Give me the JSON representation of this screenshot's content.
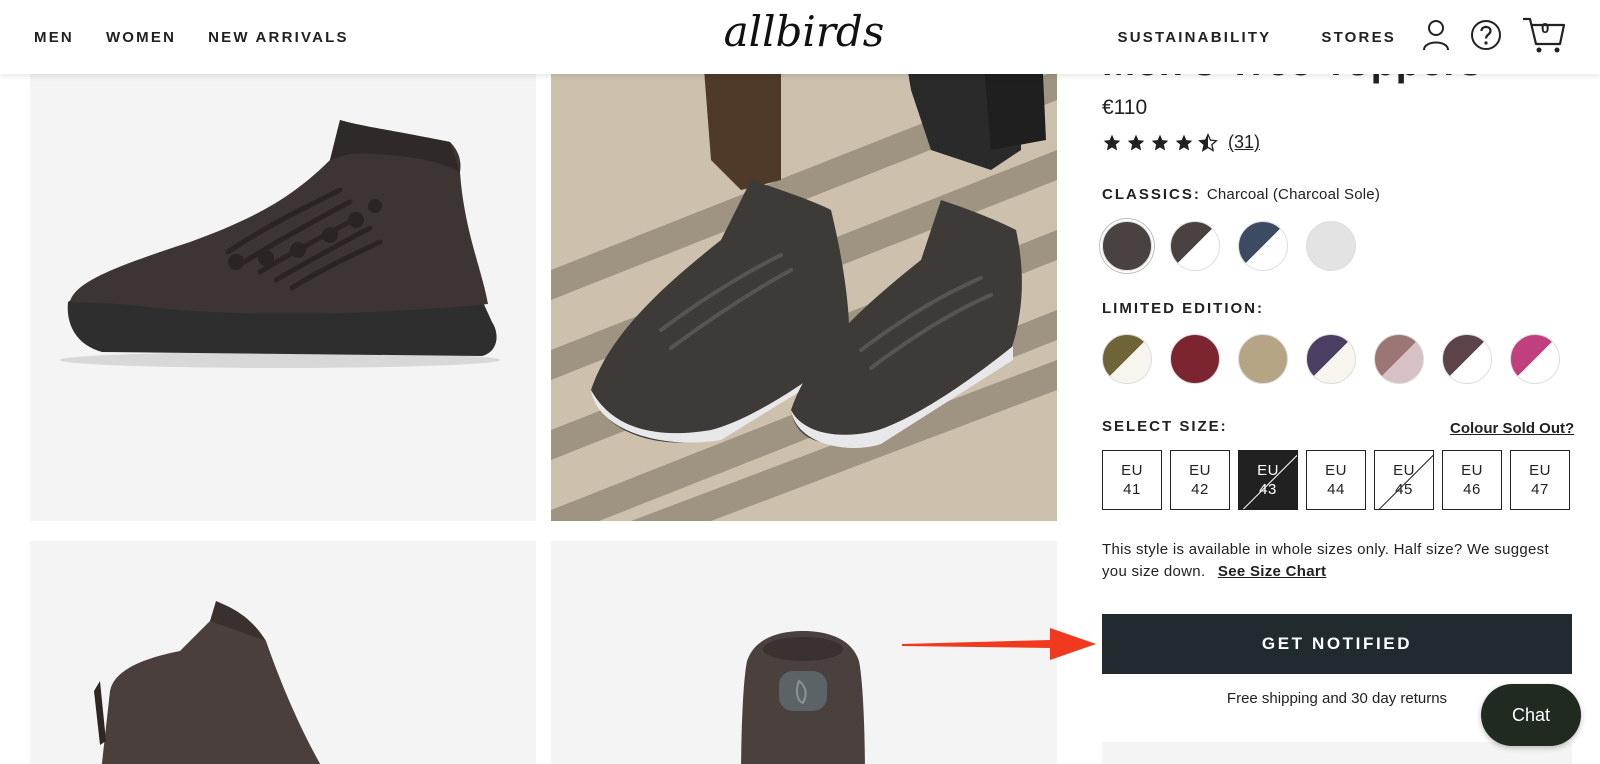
{
  "header": {
    "nav_left": [
      "MEN",
      "WOMEN",
      "NEW ARRIVALS"
    ],
    "logo_text": "allbirds",
    "sustainability": "SUSTAINABILITY",
    "stores": "STORES",
    "cart_count": "0",
    "icons": [
      "user-icon",
      "help-icon",
      "cart-icon"
    ]
  },
  "product": {
    "title": "Men's Tree Toppers",
    "price": "€110",
    "rating": 4.5,
    "review_count": "(31)",
    "classics_label": "CLASSICS:",
    "classics_value": "Charcoal (Charcoal Sole)",
    "limited_label": "LIMITED EDITION:",
    "classics_swatches": [
      {
        "name": "charcoal",
        "top": "#4a4240",
        "bottom": "#4a4240",
        "selected": true
      },
      {
        "name": "charcoal-white",
        "top": "#4a4240",
        "bottom": "#ffffff",
        "selected": false
      },
      {
        "name": "navy-white",
        "top": "#3c4a62",
        "bottom": "#ffffff",
        "selected": false
      },
      {
        "name": "light-grey",
        "top": "#e3e3e3",
        "bottom": "#e3e3e3",
        "selected": false
      }
    ],
    "limited_swatches": [
      {
        "name": "olive-cream",
        "top": "#6f6338",
        "bottom": "#f7f5ee"
      },
      {
        "name": "burgundy",
        "top": "#7c2430",
        "bottom": "#7c2430"
      },
      {
        "name": "sand",
        "top": "#b6a585",
        "bottom": "#b6a585"
      },
      {
        "name": "purple-cream",
        "top": "#4c3e62",
        "bottom": "#f7f5ee"
      },
      {
        "name": "mauve-blush",
        "top": "#9b7675",
        "bottom": "#d6c2c5"
      },
      {
        "name": "plum-white",
        "top": "#5c434a",
        "bottom": "#ffffff"
      },
      {
        "name": "magenta-white",
        "top": "#c23f7e",
        "bottom": "#ffffff"
      }
    ],
    "size_label": "SELECT SIZE:",
    "colour_sold_out": "Colour Sold Out?",
    "sizes": [
      {
        "line1": "EU",
        "line2": "41",
        "unavailable": false,
        "selected": false
      },
      {
        "line1": "EU",
        "line2": "42",
        "unavailable": false,
        "selected": false
      },
      {
        "line1": "EU",
        "line2": "43",
        "unavailable": true,
        "selected": true
      },
      {
        "line1": "EU",
        "line2": "44",
        "unavailable": false,
        "selected": false
      },
      {
        "line1": "EU",
        "line2": "45",
        "unavailable": true,
        "selected": false
      },
      {
        "line1": "EU",
        "line2": "46",
        "unavailable": false,
        "selected": false
      },
      {
        "line1": "EU",
        "line2": "47",
        "unavailable": false,
        "selected": false
      }
    ],
    "size_note": "This style is available in whole sizes only. Half size? We suggest you size down.",
    "size_chart_link": "See Size Chart",
    "cta": "GET NOTIFIED",
    "shipping": "Free shipping and 30 day returns"
  },
  "chat": {
    "label": "Chat"
  },
  "colors": {
    "dark_button": "#212a2f",
    "arrow": "#f03a1f",
    "chat_bg": "#212a20"
  }
}
